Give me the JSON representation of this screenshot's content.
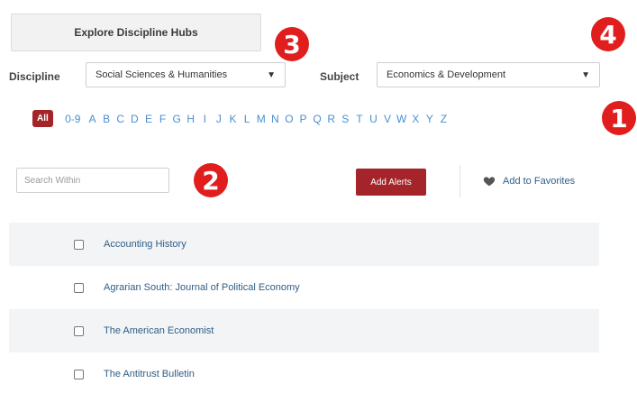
{
  "explore_button": "Explore Discipline Hubs",
  "badges": [
    "1",
    "2",
    "3",
    "4"
  ],
  "filters": {
    "discipline_label": "Discipline",
    "discipline_value": "Social Sciences & Humanities",
    "subject_label": "Subject",
    "subject_value": "Economics & Development"
  },
  "alphabet": {
    "all": "All",
    "letters": [
      "0-9",
      "A",
      "B",
      "C",
      "D",
      "E",
      "F",
      "G",
      "H",
      "I",
      "J",
      "K",
      "L",
      "M",
      "N",
      "O",
      "P",
      "Q",
      "R",
      "S",
      "T",
      "U",
      "V",
      "W",
      "X",
      "Y",
      "Z"
    ]
  },
  "search": {
    "placeholder": "Search Within"
  },
  "actions": {
    "add_alerts": "Add Alerts",
    "add_favorites": "Add to Favorites"
  },
  "journals": [
    "Accounting History",
    "Agrarian South: Journal of Political Economy",
    "The American Economist",
    "The Antitrust Bulletin"
  ],
  "colors": {
    "accent": "#a52429",
    "badge": "#e01e1e",
    "link": "#2f5d86",
    "letter": "#4a8fd0"
  }
}
